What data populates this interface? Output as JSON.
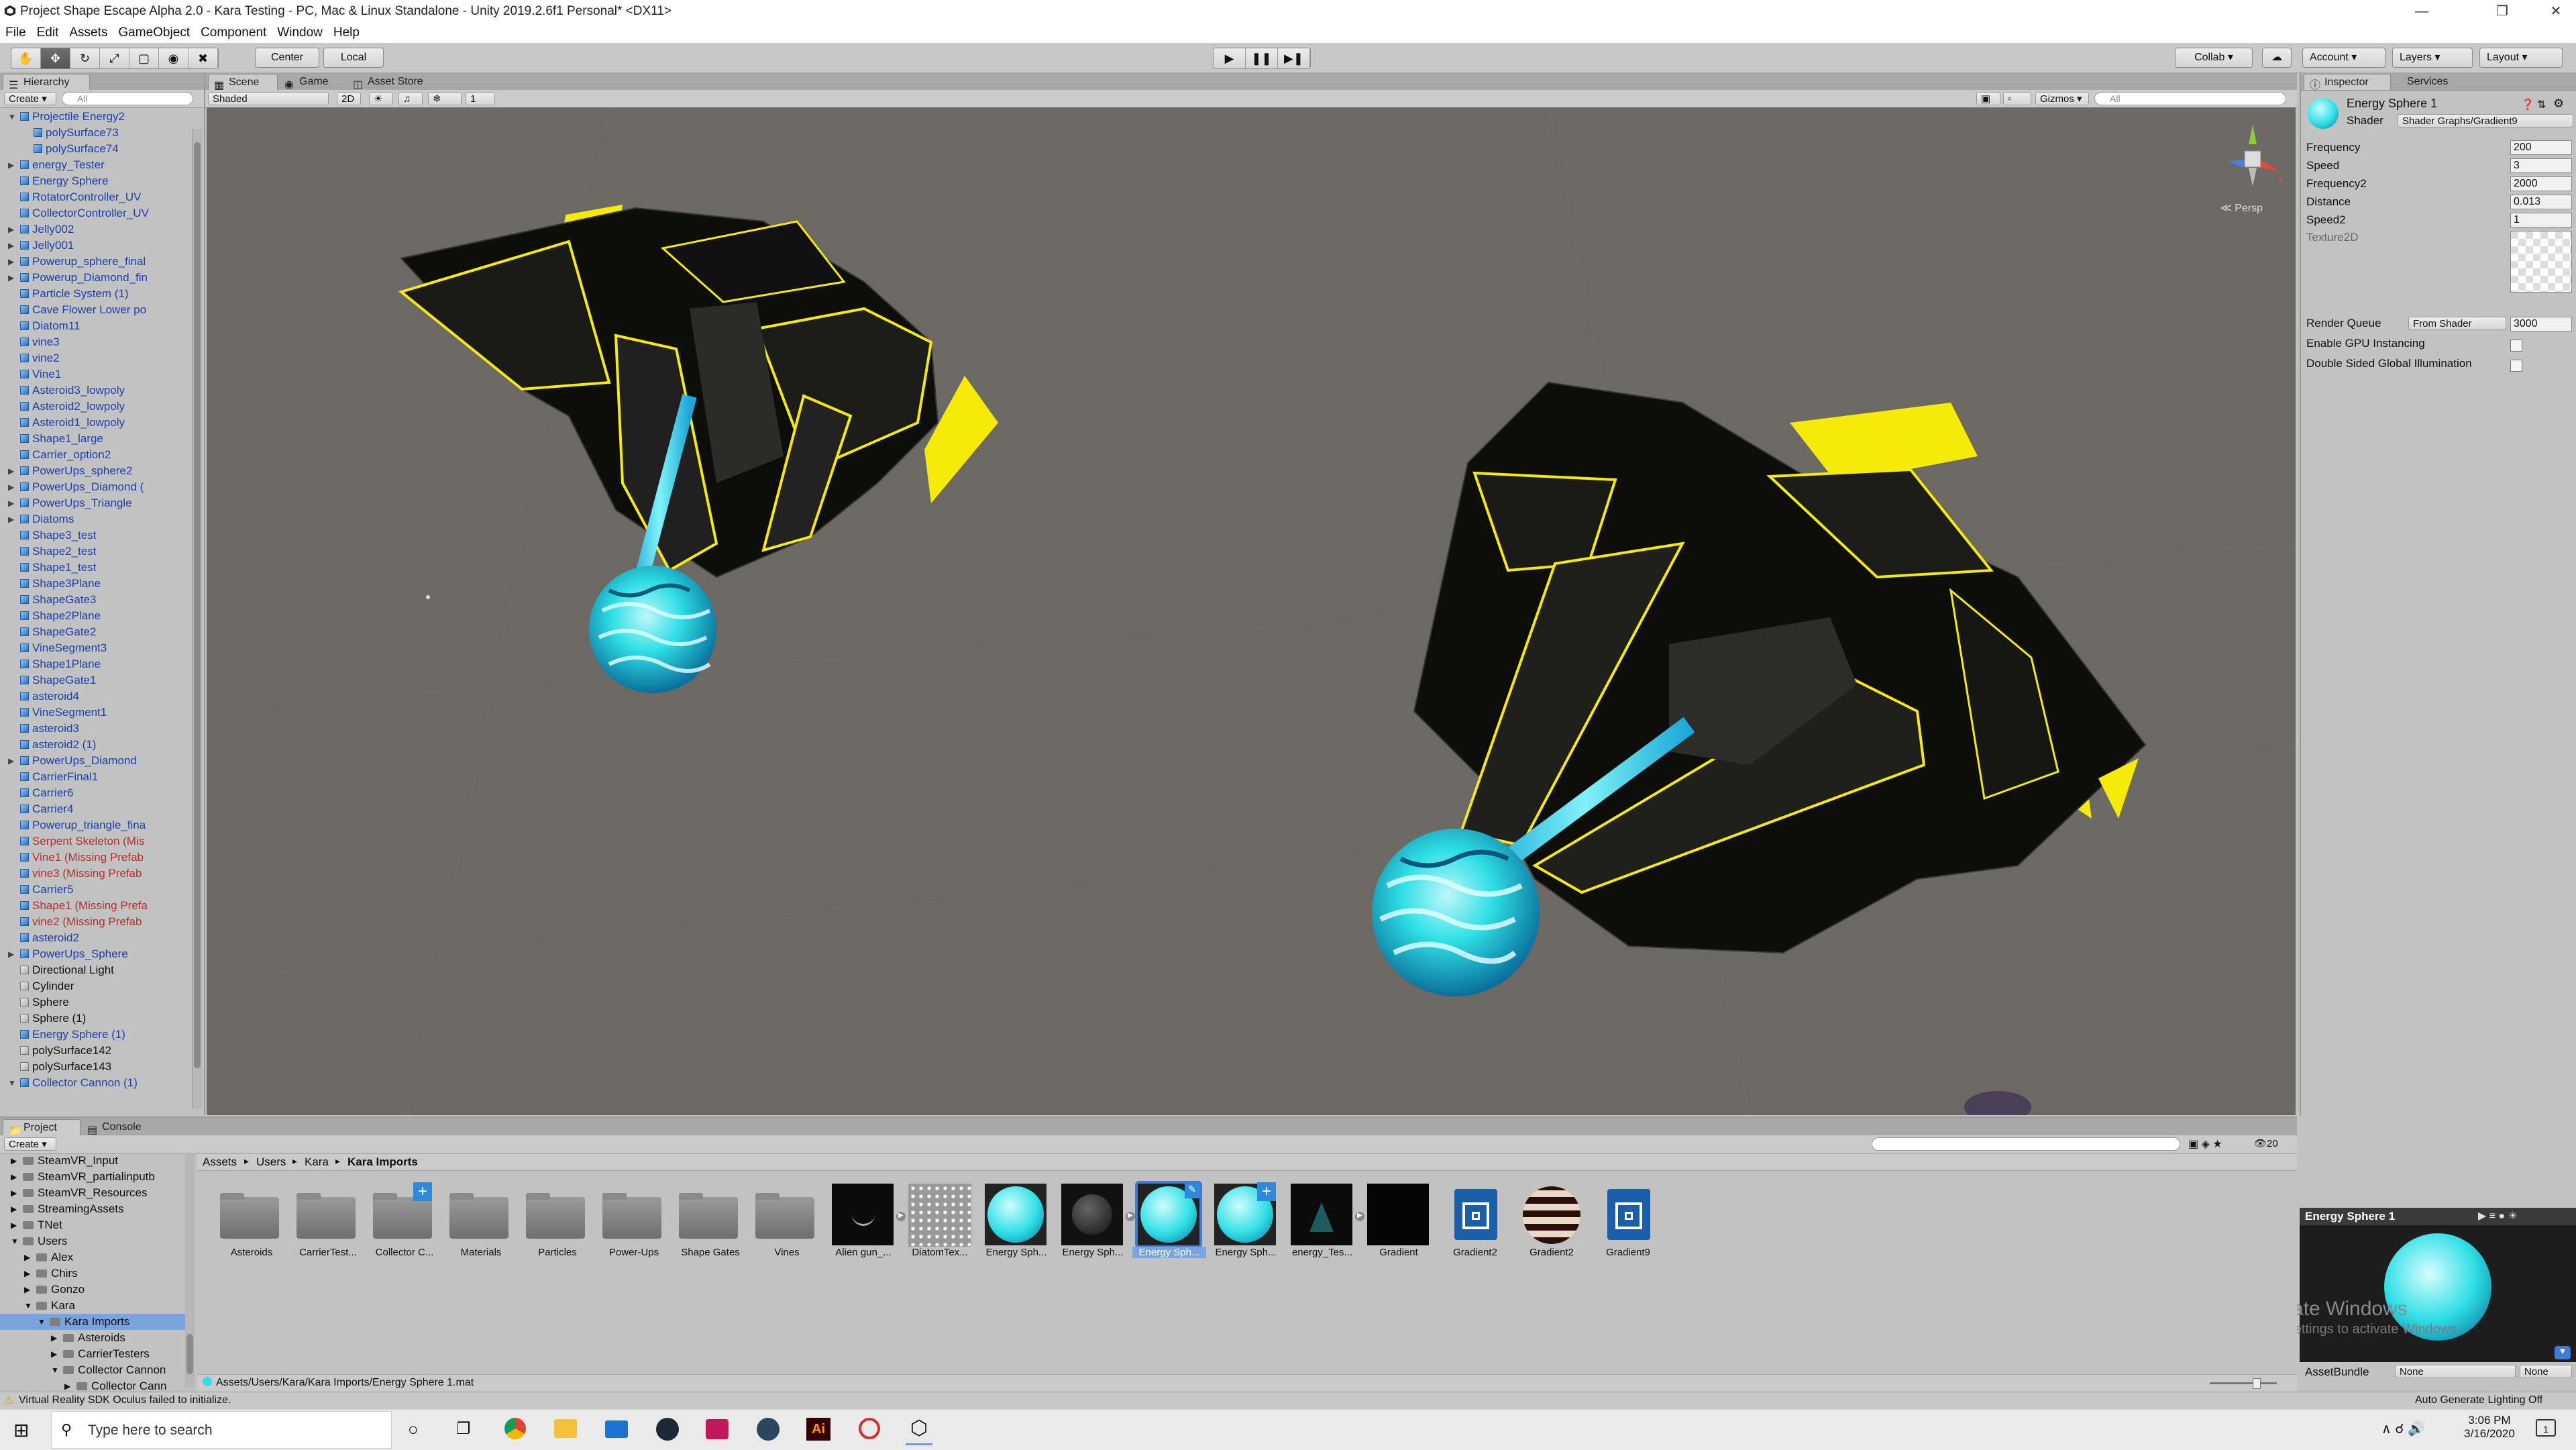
{
  "window": {
    "title": "Project Shape Escape Alpha 2.0 - Kara Testing - PC, Mac & Linux Standalone - Unity 2019.2.6f1 Personal* <DX11>"
  },
  "menu": [
    "File",
    "Edit",
    "Assets",
    "GameObject",
    "Component",
    "Window",
    "Help"
  ],
  "toolbar": {
    "pivot": "Center",
    "space": "Local",
    "collab": "Collab ▾",
    "account": "Account",
    "layers": "Layers",
    "layout": "Layout"
  },
  "hierarchy": {
    "tab": "Hierarchy",
    "create": "Create ▾",
    "search": "All",
    "items": [
      "Projectile Energy2",
      "polySurface73",
      "polySurface74",
      "energy_Tester",
      "Energy Sphere",
      "RotatorController_UV",
      "CollectorController_UV",
      "Jelly002",
      "Jelly001",
      "Powerup_sphere_final",
      "Powerup_Diamond_fin",
      "Particle System (1)",
      "Cave Flower Lower po",
      "Diatom11",
      "vine3",
      "vine2",
      "Vine1",
      "Asteroid3_lowpoly",
      "Asteroid2_lowpoly",
      "Asteroid1_lowpoly",
      "Shape1_large",
      "Carrier_option2",
      "PowerUps_sphere2",
      "PowerUps_Diamond (",
      "PowerUps_Triangle",
      "Diatoms",
      "Shape3_test",
      "Shape2_test",
      "Shape1_test",
      "Shape3Plane",
      "ShapeGate3",
      "Shape2Plane",
      "ShapeGate2",
      "VineSegment3",
      "Shape1Plane",
      "ShapeGate1",
      "asteroid4",
      "VineSegment1",
      "asteroid3",
      "asteroid2 (1)",
      "PowerUps_Diamond",
      "CarrierFinal1",
      "Carrier6",
      "Carrier4",
      "Powerup_triangle_fina",
      "Serpent Skeleton (Mis",
      "Vine1 (Missing Prefab",
      "vine3 (Missing Prefab",
      "Carrier5",
      "Shape1 (Missing Prefa",
      "vine2 (Missing Prefab",
      "asteroid2",
      "PowerUps_Sphere",
      "Directional Light",
      "Cylinder",
      "Sphere",
      "Sphere (1)",
      "Energy Sphere (1)",
      "polySurface142",
      "polySurface143",
      "Collector Cannon (1)"
    ]
  },
  "scene": {
    "tabs": [
      "Scene",
      "Game",
      "Asset Store"
    ],
    "shading": "Shaded",
    "mode2d": "2D",
    "fx_count": "1",
    "gizmos": "Gizmos ▾",
    "search": "All",
    "persp": "Persp"
  },
  "inspector": {
    "tabs": [
      "Inspector",
      "Services"
    ],
    "object_name": "Energy Sphere 1",
    "shader_label": "Shader",
    "shader_value": "Shader Graphs/Gradient9",
    "properties": [
      {
        "label": "Frequency",
        "value": "200"
      },
      {
        "label": "Speed",
        "value": "3"
      },
      {
        "label": "Frequency2",
        "value": "2000"
      },
      {
        "label": "Distance",
        "value": "0.013"
      },
      {
        "label": "Speed2",
        "value": "1"
      }
    ],
    "texture_label": "Texture2D",
    "render_queue_label": "Render Queue",
    "render_queue_mode": "From Shader",
    "render_queue_value": "3000",
    "gpu_instancing": "Enable GPU Instancing",
    "double_sided_gi": "Double Sided Global Illumination"
  },
  "preview": {
    "title": "Energy Sphere 1",
    "assetbundle_label": "AssetBundle",
    "assetbundle_value": "None",
    "variant_value": "None",
    "watermark1": "Activate Windows",
    "watermark2": "Go to Settings to activate Windows."
  },
  "project": {
    "tabs": [
      "Project",
      "Console"
    ],
    "create": "Create ▾",
    "count": "20",
    "tree": [
      {
        "label": "SteamVR_Input",
        "indent": 1
      },
      {
        "label": "SteamVR_partialinputb",
        "indent": 1
      },
      {
        "label": "SteamVR_Resources",
        "indent": 1
      },
      {
        "label": "StreamingAssets",
        "indent": 1
      },
      {
        "label": "TNet",
        "indent": 1
      },
      {
        "label": "Users",
        "indent": 1
      },
      {
        "label": "Alex",
        "indent": 2
      },
      {
        "label": "Chirs",
        "indent": 2
      },
      {
        "label": "Gonzo",
        "indent": 2
      },
      {
        "label": "Kara",
        "indent": 2
      },
      {
        "label": "Kara Imports",
        "indent": 3
      },
      {
        "label": "Asteroids",
        "indent": 4
      },
      {
        "label": "CarrierTesters",
        "indent": 4
      },
      {
        "label": "Collector Cannon",
        "indent": 4
      },
      {
        "label": "Collector Cann",
        "indent": 5
      }
    ],
    "breadcrumb": [
      "Assets",
      "Users",
      "Kara",
      "Kara Imports"
    ],
    "assets": [
      {
        "label": "Asteroids",
        "kind": "folder"
      },
      {
        "label": "CarrierTest...",
        "kind": "folder"
      },
      {
        "label": "Collector C...",
        "kind": "folder"
      },
      {
        "label": "Materials",
        "kind": "folder"
      },
      {
        "label": "Particles",
        "kind": "folder"
      },
      {
        "label": "Power-Ups",
        "kind": "folder"
      },
      {
        "label": "Shape Gates",
        "kind": "folder"
      },
      {
        "label": "Vines",
        "kind": "folder"
      },
      {
        "label": "Alien gun_...",
        "kind": "dark"
      },
      {
        "label": "DiatomTex...",
        "kind": "texture"
      },
      {
        "label": "Energy Sph...",
        "kind": "sphere"
      },
      {
        "label": "Energy Sph...",
        "kind": "darksphere"
      },
      {
        "label": "Energy Sph...",
        "kind": "sphere-selected"
      },
      {
        "label": "Energy Sph...",
        "kind": "sphere"
      },
      {
        "label": "energy_Tes...",
        "kind": "dark"
      },
      {
        "label": "Gradient",
        "kind": "black"
      },
      {
        "label": "Gradient2",
        "kind": "graph"
      },
      {
        "label": "Gradient2",
        "kind": "stripes"
      },
      {
        "label": "Gradient9",
        "kind": "graph"
      }
    ],
    "path": "Assets/Users/Kara/Kara Imports/Energy Sphere 1.mat"
  },
  "status": {
    "message": "Virtual Reality SDK Oculus failed to initialize.",
    "lighting": "Auto Generate Lighting Off"
  },
  "taskbar": {
    "search_placeholder": "Type here to search",
    "time": "3:06 PM",
    "date": "3/16/2020",
    "notification_count": "1"
  },
  "colors": {
    "accent_cyan": "#2fe0e6",
    "ship_yellow": "#f5ea08",
    "scene_bg": "#6c6863",
    "selection_blue": "#3e7bd8"
  }
}
